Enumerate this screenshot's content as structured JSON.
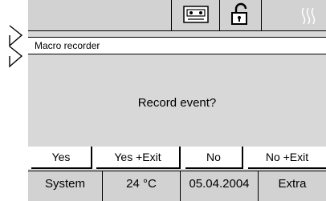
{
  "title_bar": {
    "title": "Macro recorder"
  },
  "top_icons": [
    "cassette-icon",
    "lock-open-icon",
    "heat-waves-icon"
  ],
  "dialog": {
    "question": "Record event?"
  },
  "buttons": {
    "yes": "Yes",
    "yes_exit": "Yes +Exit",
    "no": "No",
    "no_exit": "No +Exit"
  },
  "status": {
    "system": "System",
    "temperature": "24 °C",
    "date": "05.04.2004",
    "extra": "Extra"
  },
  "colors": {
    "panel": "#d8d8d8",
    "bar": "#d2d2d2",
    "active": "#ffffff"
  }
}
